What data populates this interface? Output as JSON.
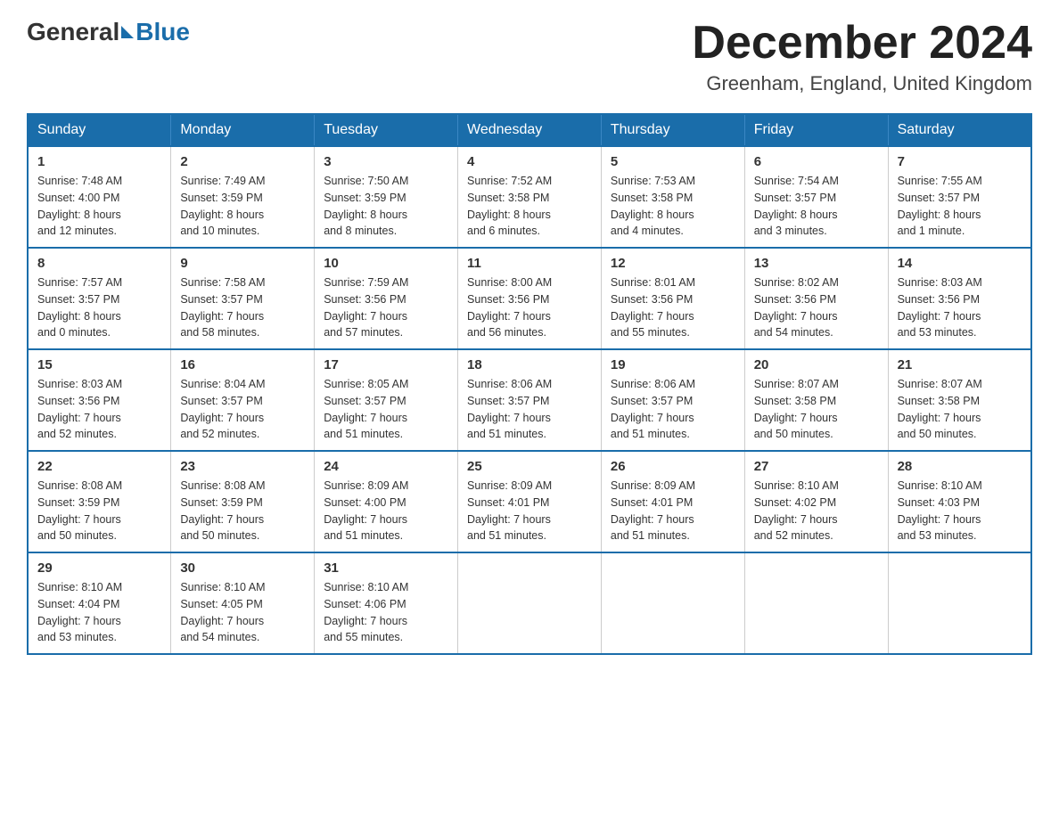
{
  "header": {
    "logo_general": "General",
    "logo_blue": "Blue",
    "month_title": "December 2024",
    "location": "Greenham, England, United Kingdom"
  },
  "weekdays": [
    "Sunday",
    "Monday",
    "Tuesday",
    "Wednesday",
    "Thursday",
    "Friday",
    "Saturday"
  ],
  "rows": [
    [
      {
        "day": "1",
        "sunrise": "7:48 AM",
        "sunset": "4:00 PM",
        "daylight": "8 hours and 12 minutes."
      },
      {
        "day": "2",
        "sunrise": "7:49 AM",
        "sunset": "3:59 PM",
        "daylight": "8 hours and 10 minutes."
      },
      {
        "day": "3",
        "sunrise": "7:50 AM",
        "sunset": "3:59 PM",
        "daylight": "8 hours and 8 minutes."
      },
      {
        "day": "4",
        "sunrise": "7:52 AM",
        "sunset": "3:58 PM",
        "daylight": "8 hours and 6 minutes."
      },
      {
        "day": "5",
        "sunrise": "7:53 AM",
        "sunset": "3:58 PM",
        "daylight": "8 hours and 4 minutes."
      },
      {
        "day": "6",
        "sunrise": "7:54 AM",
        "sunset": "3:57 PM",
        "daylight": "8 hours and 3 minutes."
      },
      {
        "day": "7",
        "sunrise": "7:55 AM",
        "sunset": "3:57 PM",
        "daylight": "8 hours and 1 minute."
      }
    ],
    [
      {
        "day": "8",
        "sunrise": "7:57 AM",
        "sunset": "3:57 PM",
        "daylight": "8 hours and 0 minutes."
      },
      {
        "day": "9",
        "sunrise": "7:58 AM",
        "sunset": "3:57 PM",
        "daylight": "7 hours and 58 minutes."
      },
      {
        "day": "10",
        "sunrise": "7:59 AM",
        "sunset": "3:56 PM",
        "daylight": "7 hours and 57 minutes."
      },
      {
        "day": "11",
        "sunrise": "8:00 AM",
        "sunset": "3:56 PM",
        "daylight": "7 hours and 56 minutes."
      },
      {
        "day": "12",
        "sunrise": "8:01 AM",
        "sunset": "3:56 PM",
        "daylight": "7 hours and 55 minutes."
      },
      {
        "day": "13",
        "sunrise": "8:02 AM",
        "sunset": "3:56 PM",
        "daylight": "7 hours and 54 minutes."
      },
      {
        "day": "14",
        "sunrise": "8:03 AM",
        "sunset": "3:56 PM",
        "daylight": "7 hours and 53 minutes."
      }
    ],
    [
      {
        "day": "15",
        "sunrise": "8:03 AM",
        "sunset": "3:56 PM",
        "daylight": "7 hours and 52 minutes."
      },
      {
        "day": "16",
        "sunrise": "8:04 AM",
        "sunset": "3:57 PM",
        "daylight": "7 hours and 52 minutes."
      },
      {
        "day": "17",
        "sunrise": "8:05 AM",
        "sunset": "3:57 PM",
        "daylight": "7 hours and 51 minutes."
      },
      {
        "day": "18",
        "sunrise": "8:06 AM",
        "sunset": "3:57 PM",
        "daylight": "7 hours and 51 minutes."
      },
      {
        "day": "19",
        "sunrise": "8:06 AM",
        "sunset": "3:57 PM",
        "daylight": "7 hours and 51 minutes."
      },
      {
        "day": "20",
        "sunrise": "8:07 AM",
        "sunset": "3:58 PM",
        "daylight": "7 hours and 50 minutes."
      },
      {
        "day": "21",
        "sunrise": "8:07 AM",
        "sunset": "3:58 PM",
        "daylight": "7 hours and 50 minutes."
      }
    ],
    [
      {
        "day": "22",
        "sunrise": "8:08 AM",
        "sunset": "3:59 PM",
        "daylight": "7 hours and 50 minutes."
      },
      {
        "day": "23",
        "sunrise": "8:08 AM",
        "sunset": "3:59 PM",
        "daylight": "7 hours and 50 minutes."
      },
      {
        "day": "24",
        "sunrise": "8:09 AM",
        "sunset": "4:00 PM",
        "daylight": "7 hours and 51 minutes."
      },
      {
        "day": "25",
        "sunrise": "8:09 AM",
        "sunset": "4:01 PM",
        "daylight": "7 hours and 51 minutes."
      },
      {
        "day": "26",
        "sunrise": "8:09 AM",
        "sunset": "4:01 PM",
        "daylight": "7 hours and 51 minutes."
      },
      {
        "day": "27",
        "sunrise": "8:10 AM",
        "sunset": "4:02 PM",
        "daylight": "7 hours and 52 minutes."
      },
      {
        "day": "28",
        "sunrise": "8:10 AM",
        "sunset": "4:03 PM",
        "daylight": "7 hours and 53 minutes."
      }
    ],
    [
      {
        "day": "29",
        "sunrise": "8:10 AM",
        "sunset": "4:04 PM",
        "daylight": "7 hours and 53 minutes."
      },
      {
        "day": "30",
        "sunrise": "8:10 AM",
        "sunset": "4:05 PM",
        "daylight": "7 hours and 54 minutes."
      },
      {
        "day": "31",
        "sunrise": "8:10 AM",
        "sunset": "4:06 PM",
        "daylight": "7 hours and 55 minutes."
      },
      null,
      null,
      null,
      null
    ]
  ],
  "labels": {
    "sunrise": "Sunrise:",
    "sunset": "Sunset:",
    "daylight": "Daylight:"
  }
}
